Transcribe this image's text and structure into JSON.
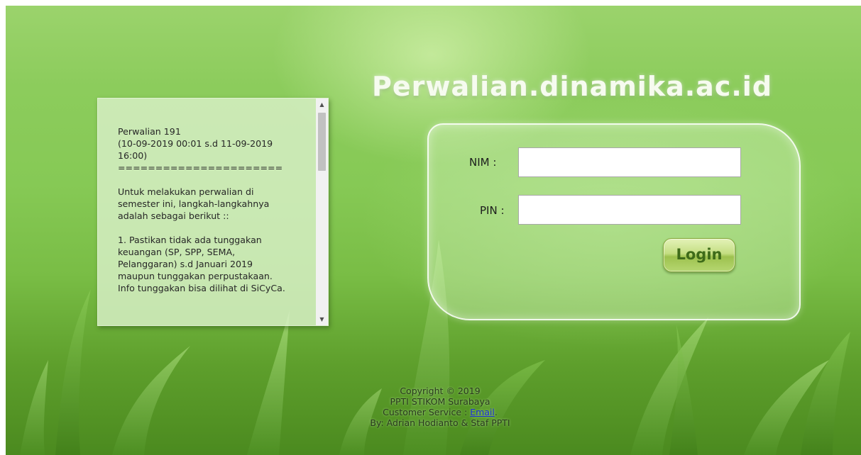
{
  "header": {
    "site_title": "Perwalian.dinamika.ac.id"
  },
  "info_panel": {
    "text": "Perwalian 191\n(10-09-2019 00:01 s.d 11-09-2019\n16:00)\n======================\n\nUntuk melakukan perwalian di\nsemester ini, langkah-langkahnya\nadalah sebagai berikut ::\n\n1. Pastikan tidak ada tunggakan\nkeuangan (SP, SPP, SEMA,\nPelanggaran) s.d Januari 2019\nmaupun tunggakan perpustakaan.\nInfo tunggakan bisa dilihat di SiCyCa."
  },
  "login_form": {
    "nim_label": "NIM :",
    "nim_value": "",
    "pin_label": "PIN :",
    "pin_value": "",
    "login_button": "Login"
  },
  "footer": {
    "copyright": "Copyright © 2019",
    "org": "PPTI STIKOM Surabaya",
    "cs_prefix": "Customer Service : ",
    "cs_link": "Email",
    "cs_suffix": ".",
    "credits": "By: Adrian Hodianto & Staf PPTI"
  },
  "colors": {
    "background_green": "#86c955",
    "title_text": "#f6fbef",
    "login_button": "#9dc24e",
    "link": "#1a2fd6"
  }
}
